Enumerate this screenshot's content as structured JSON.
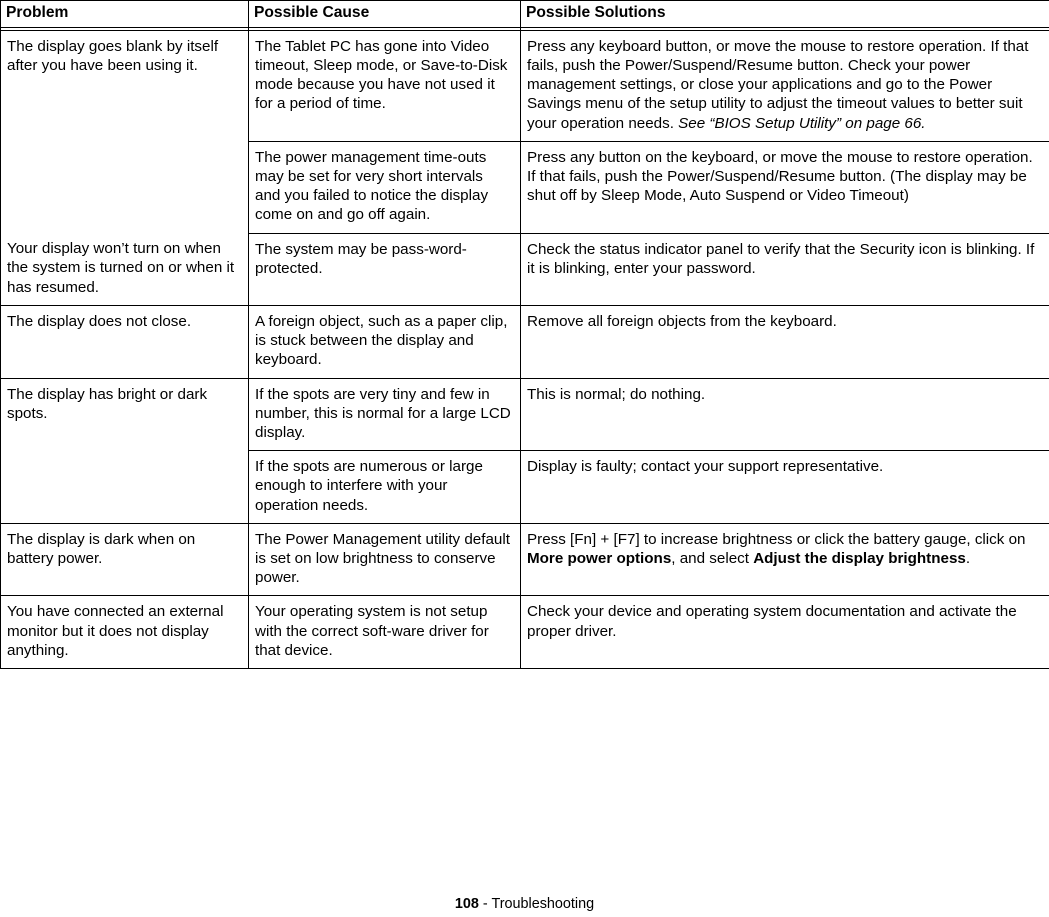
{
  "footer": {
    "page_number": "108",
    "separator": " - ",
    "section": "Troubleshooting"
  },
  "table": {
    "columns": [
      {
        "label": "Problem"
      },
      {
        "label": "Possible Cause"
      },
      {
        "label": "Possible Solutions"
      }
    ],
    "rows": [
      {
        "problem": "The display goes blank by itself after you have been using it.",
        "causes": [
          {
            "cause": "The Tablet PC has gone into Video timeout, Sleep mode, or Save-to-Disk mode because you have not used it for a period of time.",
            "solution_pre": "Press any keyboard button, or move the mouse to restore operation. If that fails, push the Power/Suspend/Resume button. Check your power management settings, or close your applications and go to the Power Savings menu of the setup utility to adjust the timeout values to better suit your operation needs. ",
            "solution_italic": "See “BIOS Setup Utility” on page 66.",
            "solution_post": ""
          },
          {
            "cause": "The power management time-outs may be set for very short intervals and you failed to notice the display come on and go off again.",
            "solution_pre": "Press any button on the keyboard, or move the mouse to restore operation. If that fails, push the Power/Suspend/Resume button. (The display may be shut off by Sleep Mode, Auto Suspend or Video Timeout)",
            "solution_italic": "",
            "solution_post": ""
          }
        ]
      },
      {
        "problem": "Your display won’t turn on when the system is turned on or when it has resumed.",
        "causes": [
          {
            "cause": "The system may be pass-word-protected.",
            "solution_pre": "Check the status indicator panel to verify that the Security icon is blinking. If it is blinking, enter your password.",
            "solution_italic": "",
            "solution_post": ""
          }
        ]
      },
      {
        "problem": "The display does not close.",
        "causes": [
          {
            "cause": "A foreign object, such as a paper clip, is stuck between the display and keyboard.",
            "solution_pre": "Remove all foreign objects from the keyboard.",
            "solution_italic": "",
            "solution_post": ""
          }
        ]
      },
      {
        "problem": "The display has bright or dark spots.",
        "causes": [
          {
            "cause": "If the spots are very tiny and few in number, this is normal for a large LCD display.",
            "solution_pre": "This is normal; do nothing.",
            "solution_italic": "",
            "solution_post": ""
          },
          {
            "cause": "If the spots are numerous or large enough to interfere with your operation needs.",
            "solution_pre": "Display is faulty; contact your support representative.",
            "solution_italic": "",
            "solution_post": ""
          }
        ]
      },
      {
        "problem": "The display is dark when on battery power.",
        "causes": [
          {
            "cause": "The Power Management utility default is set on low brightness to conserve power.",
            "solution_pre": "Press [Fn] + [F7] to increase brightness or click the battery gauge, click on ",
            "solution_bold_1": "More power options",
            "solution_mid": ", and select ",
            "solution_bold_2": "Adjust the display brightness",
            "solution_post": "."
          }
        ]
      },
      {
        "problem": "You have connected an external monitor but it does not display anything.",
        "causes": [
          {
            "cause": "Your operating system is not setup with the correct soft-ware driver for that device.",
            "solution_pre": "Check your device and operating system documentation and activate the proper driver.",
            "solution_italic": "",
            "solution_post": ""
          }
        ]
      }
    ]
  }
}
